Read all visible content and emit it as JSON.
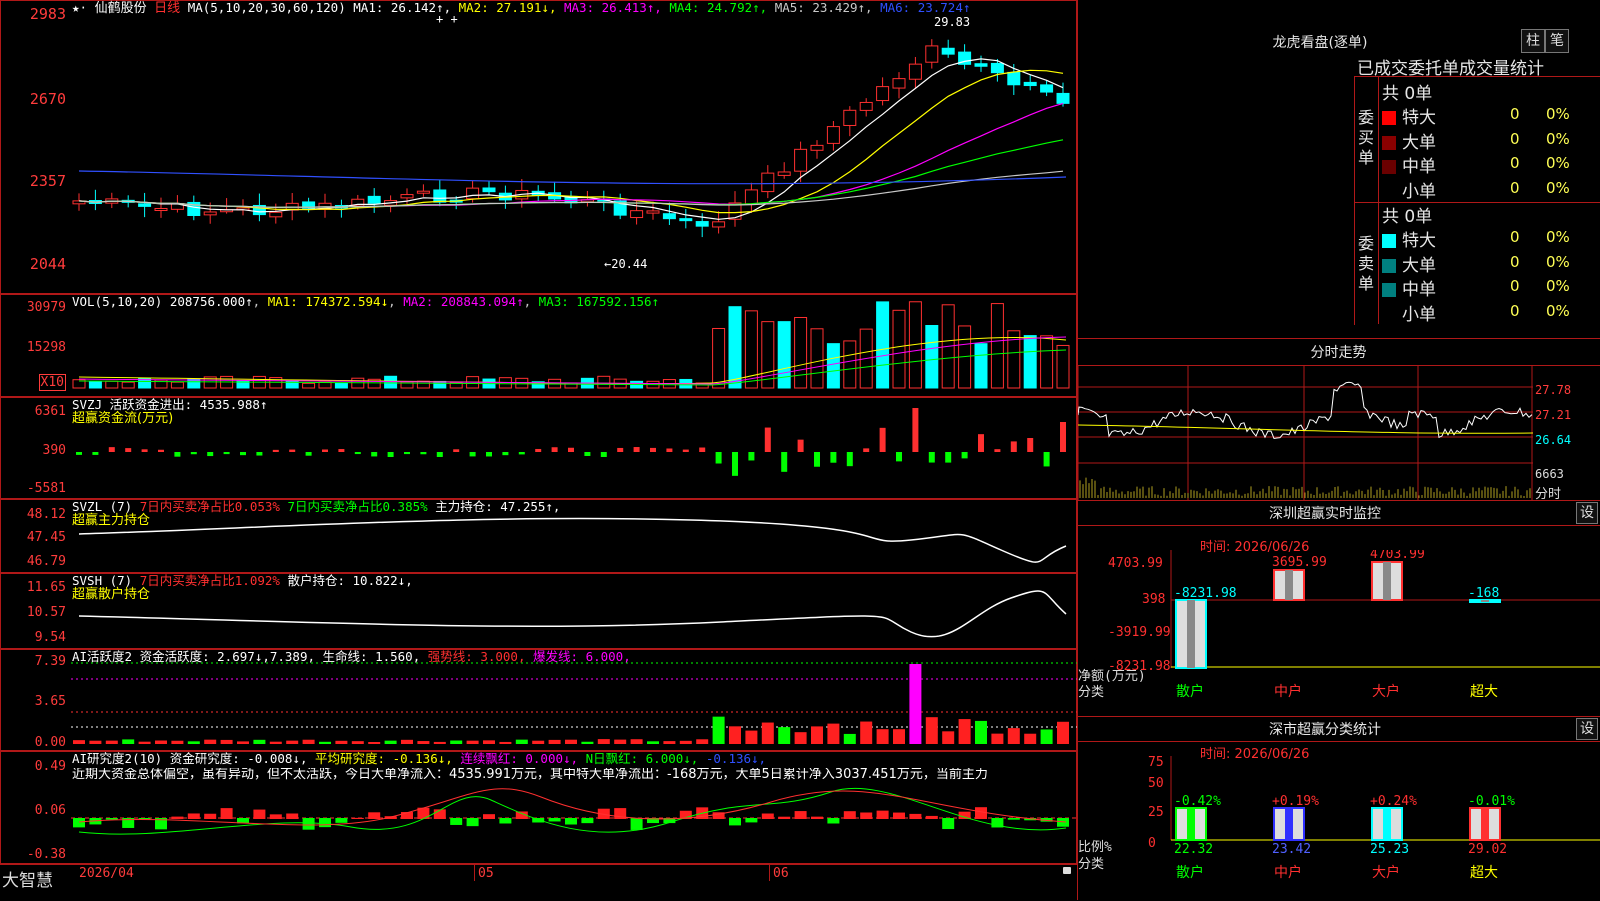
{
  "main": {
    "star_icon": "★·",
    "name": "仙鹤股份",
    "period": "日线",
    "ma_title": "MA(5,10,20,30,60,120)",
    "ma_values": [
      {
        "label": "MA1:",
        "value": "26.142↑",
        "color": "#ffffff"
      },
      {
        "label": "MA2:",
        "value": "27.191↓",
        "color": "#ffff00"
      },
      {
        "label": "MA3:",
        "value": "26.413↑",
        "color": "#ff00ff"
      },
      {
        "label": "MA4:",
        "value": "24.792↑",
        "color": "#00ff00"
      },
      {
        "label": "MA5:",
        "value": "23.429↑",
        "color": "#c8c8c8"
      },
      {
        "label": "MA6:",
        "value": "23.724↑",
        "color": "#3050ff"
      }
    ],
    "y_ticks": [
      "2983",
      "2670",
      "2357",
      "2044"
    ],
    "hi_label": "29.83",
    "lo_label": "←20.44",
    "plus_marks": "+ +"
  },
  "vol": {
    "title": "VOL(5,10,20)",
    "value": "208756.000↑",
    "ma1": "MA1: 174372.594↓",
    "ma2": "MA2: 208843.094↑",
    "ma3": "MA3: 167592.156↑",
    "y_ticks": [
      "30979",
      "15298"
    ],
    "x10": "X10"
  },
  "svzj": {
    "title": "SVZJ  活跃资金进出: 4535.988↑",
    "subtitle": "超赢资金流(万元)",
    "y_ticks": [
      "6361",
      "390",
      "-5581"
    ]
  },
  "svzl": {
    "name": "SVZL (7)",
    "ratio1": "7日内买卖净占比0.053%",
    "ratio2": "7日内买卖净占比0.385%",
    "hold": "主力持仓: 47.255↑,",
    "subtitle": "超赢主力持仓",
    "y_ticks": [
      "48.12",
      "47.45",
      "46.79"
    ]
  },
  "svsh": {
    "name": "SVSH (7)",
    "ratio": "7日内买卖净占比1.092%",
    "hold": "散户持仓: 10.822↓,",
    "subtitle": "超赢散户持仓",
    "y_ticks": [
      "11.65",
      "10.57",
      "9.54"
    ]
  },
  "ai1": {
    "title": "AI活跃度2",
    "a1": "资金活跃度: 2.697↓,7.389,",
    "a2": "生命线: 1.560,",
    "a3": "强势线: 3.000,",
    "a4": "爆发线: 6.000,",
    "y_ticks": [
      "7.39",
      "3.65",
      "0.00"
    ]
  },
  "ai2": {
    "title": "AI研究度2(10)",
    "b1": "资金研究度: -0.008↓,",
    "b2": "平均研究度: -0.136↓,",
    "b3": "连续飘红: 0.000↓,",
    "b4": "N日飘红: 6.000↓,",
    "b5": "-0.136↓,",
    "note": "近期大资金总体偏空，虽有异动，但不太活跃，今日大单净流入：4535.991万元，其中特大单净流出：-168万元，大单5日累计净入3037.451万元，当前主力",
    "y_ticks": [
      "0.49",
      "0.06",
      "-0.38"
    ]
  },
  "xaxis": {
    "labels": [
      "2026/04",
      "05",
      "06"
    ]
  },
  "brand": "大智慧",
  "dragon": {
    "title": "龙虎看盘(逐单)",
    "btn_zhu": "柱",
    "btn_bi": "笔",
    "tabs": "已成交委托单成交量统计",
    "buy_side": "委买单",
    "sell_side": "委卖单",
    "buy_total": "共 0单",
    "sell_total": "共 0单",
    "rows": [
      {
        "label": "特大",
        "count": "0",
        "pct": "0%"
      },
      {
        "label": "大单",
        "count": "0",
        "pct": "0%"
      },
      {
        "label": "中单",
        "count": "0",
        "pct": "0%"
      },
      {
        "label": "小单",
        "count": "0",
        "pct": "0%"
      }
    ],
    "buy_colors": [
      "#ff0000",
      "#8a0000",
      "#6a0000",
      "#000000"
    ],
    "sell_colors": [
      "#00ffff",
      "#008080",
      "#008080",
      "#000000"
    ]
  },
  "minute": {
    "title": "分时走势",
    "ticks": [
      "27.78",
      "27.21",
      "26.64",
      "6663"
    ],
    "time_label": "分时"
  },
  "szmon": {
    "title": "深圳超赢实时监控",
    "set": "设",
    "time": "时间: 2026/06/26",
    "y_ticks": [
      "4703.99",
      "398",
      "-3919.99",
      "-8231.98"
    ],
    "values": [
      "-8231.98",
      "3695.99",
      "4703.99",
      "-168"
    ],
    "cats": [
      "散户",
      "中户",
      "大户",
      "超大"
    ],
    "ylabel1": "净额(万元)",
    "ylabel2": "分类"
  },
  "szcls": {
    "title": "深市超赢分类统计",
    "set": "设",
    "time": "时间: 2026/06/26",
    "y_ticks": [
      "75",
      "50",
      "25",
      "0"
    ],
    "changes": [
      "-0.42%",
      "+0.19%",
      "+0.24%",
      "-0.01%"
    ],
    "values": [
      "22.32",
      "23.42",
      "25.23",
      "29.02"
    ],
    "cats": [
      "散户",
      "中户",
      "大户",
      "超大"
    ],
    "ylabel1": "比例%",
    "ylabel2": "分类"
  }
}
